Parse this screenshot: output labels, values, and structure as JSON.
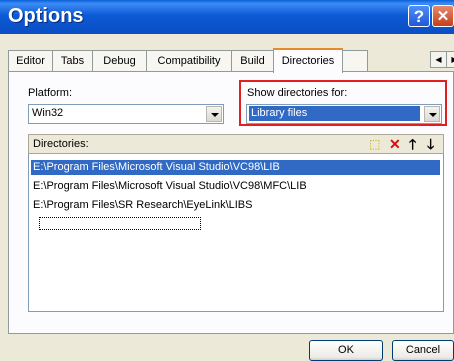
{
  "window": {
    "title": "Options",
    "help_glyph": "?",
    "close_glyph": "✕"
  },
  "tabs": [
    "Editor",
    "Tabs",
    "Debug",
    "Compatibility",
    "Build",
    "Directories"
  ],
  "active_tab": "Directories",
  "platform": {
    "label": "Platform:",
    "value": "Win32"
  },
  "show_dirs": {
    "label": "Show directories for:",
    "value": "Library files"
  },
  "directories": {
    "label": "Directories:",
    "items": [
      "E:\\Program Files\\Microsoft Visual Studio\\VC98\\LIB",
      "E:\\Program Files\\Microsoft Visual Studio\\VC98\\MFC\\LIB",
      "E:\\Program Files\\SR Research\\EyeLink\\LIBS"
    ],
    "selected_index": 0
  },
  "icons": {
    "new": "new-folder-icon",
    "delete": "delete-icon",
    "up": "move-up-icon",
    "down": "move-down-icon"
  },
  "buttons": {
    "ok": "OK",
    "cancel": "Cancel"
  },
  "colors": {
    "title_bar": "#0a5fd8",
    "selection": "#316ac5",
    "highlight_box": "#e02020",
    "active_tab_accent": "#e68b2c"
  }
}
